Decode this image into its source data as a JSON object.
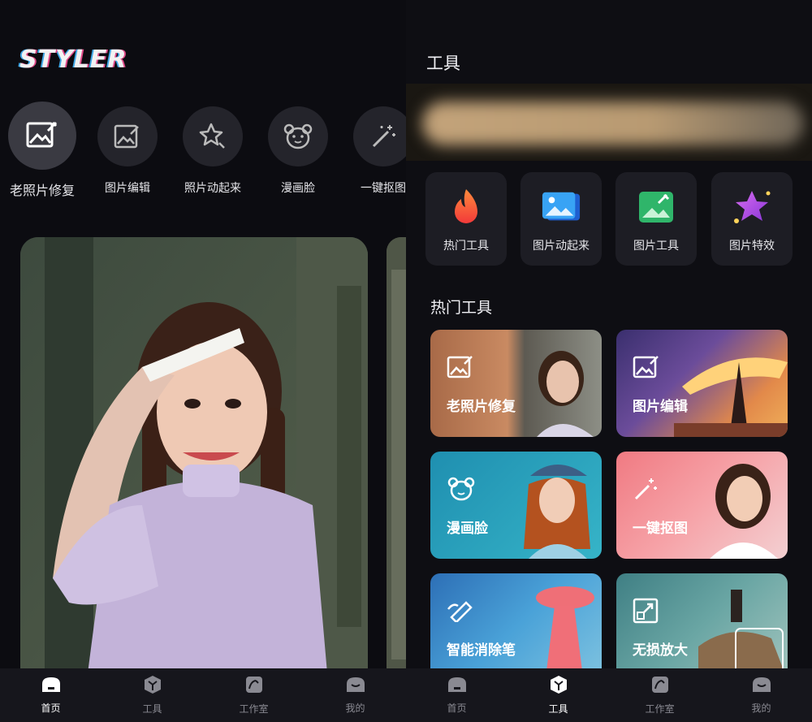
{
  "left_screen": {
    "logo": "STYLER",
    "tools": [
      {
        "label": "老照片修复",
        "icon": "photo-repair-icon"
      },
      {
        "label": "图片编辑",
        "icon": "image-edit-icon"
      },
      {
        "label": "照片动起来",
        "icon": "star-animate-icon"
      },
      {
        "label": "漫画脸",
        "icon": "bear-face-icon"
      },
      {
        "label": "一键抠图",
        "icon": "magic-wand-icon"
      }
    ]
  },
  "right_screen": {
    "title": "工具",
    "categories": [
      {
        "label": "热门工具",
        "icon": "flame-icon"
      },
      {
        "label": "图片动起来",
        "icon": "image-animate-icon"
      },
      {
        "label": "图片工具",
        "icon": "image-tool-icon"
      },
      {
        "label": "图片特效",
        "icon": "star-effect-icon"
      }
    ],
    "hot_section_title": "热门工具",
    "hot_tools": [
      {
        "label": "老照片修复",
        "icon": "photo-repair-icon"
      },
      {
        "label": "图片编辑",
        "icon": "image-edit-icon"
      },
      {
        "label": "漫画脸",
        "icon": "bear-face-icon"
      },
      {
        "label": "一键抠图",
        "icon": "magic-wand-icon"
      },
      {
        "label": "智能消除笔",
        "icon": "eraser-brush-icon"
      },
      {
        "label": "无损放大",
        "icon": "enlarge-icon"
      }
    ]
  },
  "nav": [
    {
      "label": "首页",
      "icon": "home-icon"
    },
    {
      "label": "工具",
      "icon": "tool-cube-icon"
    },
    {
      "label": "工作室",
      "icon": "studio-icon"
    },
    {
      "label": "我的",
      "icon": "profile-icon"
    }
  ],
  "left_nav_active": "首页",
  "right_nav_active": "工具",
  "colors": {
    "background": "#0c0c11",
    "card": "#1d1d24",
    "accent_pink": "#e24b8a",
    "accent_blue": "#3fa7e6"
  }
}
